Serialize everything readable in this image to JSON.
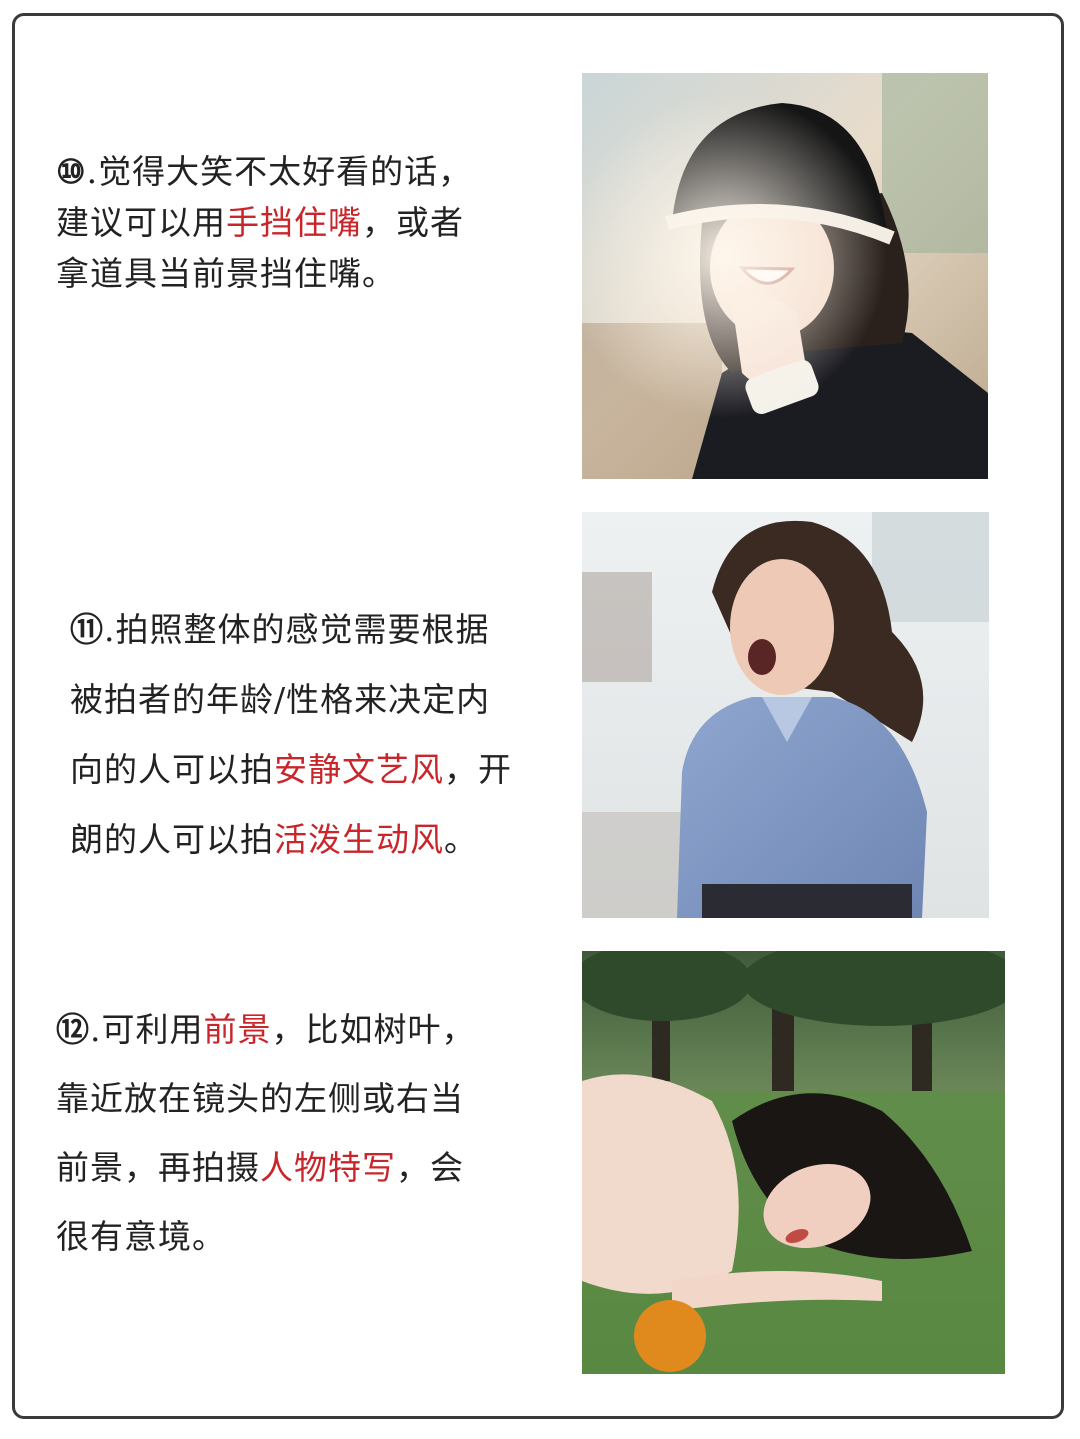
{
  "tips": [
    {
      "number": "⑩",
      "lines": [
        [
          {
            "text": ".觉得大笑不太好看的话，",
            "hl": false
          }
        ],
        [
          {
            "text": "建议可以用",
            "hl": false
          },
          {
            "text": "手挡住嘴",
            "hl": true
          },
          {
            "text": "，或者",
            "hl": false
          }
        ],
        [
          {
            "text": "拿道具当前景挡住嘴。",
            "hl": false
          }
        ]
      ]
    },
    {
      "number": "⑪",
      "lines": [
        [
          {
            "text": ".拍照整体的感觉需要根据",
            "hl": false
          }
        ],
        [
          {
            "text": "被拍者的年龄/性格来决定内",
            "hl": false
          }
        ],
        [
          {
            "text": "向的人可以拍",
            "hl": false
          },
          {
            "text": "安静文艺风",
            "hl": true
          },
          {
            "text": "，开",
            "hl": false
          }
        ],
        [
          {
            "text": "朗的人可以拍",
            "hl": false
          },
          {
            "text": "活泼生动风",
            "hl": true
          },
          {
            "text": "。",
            "hl": false
          }
        ]
      ]
    },
    {
      "number": "⑫",
      "lines": [
        [
          {
            "text": ".可利用",
            "hl": false
          },
          {
            "text": "前景",
            "hl": true
          },
          {
            "text": "，比如树叶，",
            "hl": false
          }
        ],
        [
          {
            "text": "靠近放在镜头的左侧或右当",
            "hl": false
          }
        ],
        [
          {
            "text": "前景，再拍摄",
            "hl": false
          },
          {
            "text": "人物特写",
            "hl": true
          },
          {
            "text": "，会",
            "hl": false
          }
        ],
        [
          {
            "text": "很有意境。",
            "hl": false
          }
        ]
      ]
    }
  ],
  "colors": {
    "highlight": "#c8262a",
    "text": "#222222",
    "border": "#3a3a3a"
  }
}
